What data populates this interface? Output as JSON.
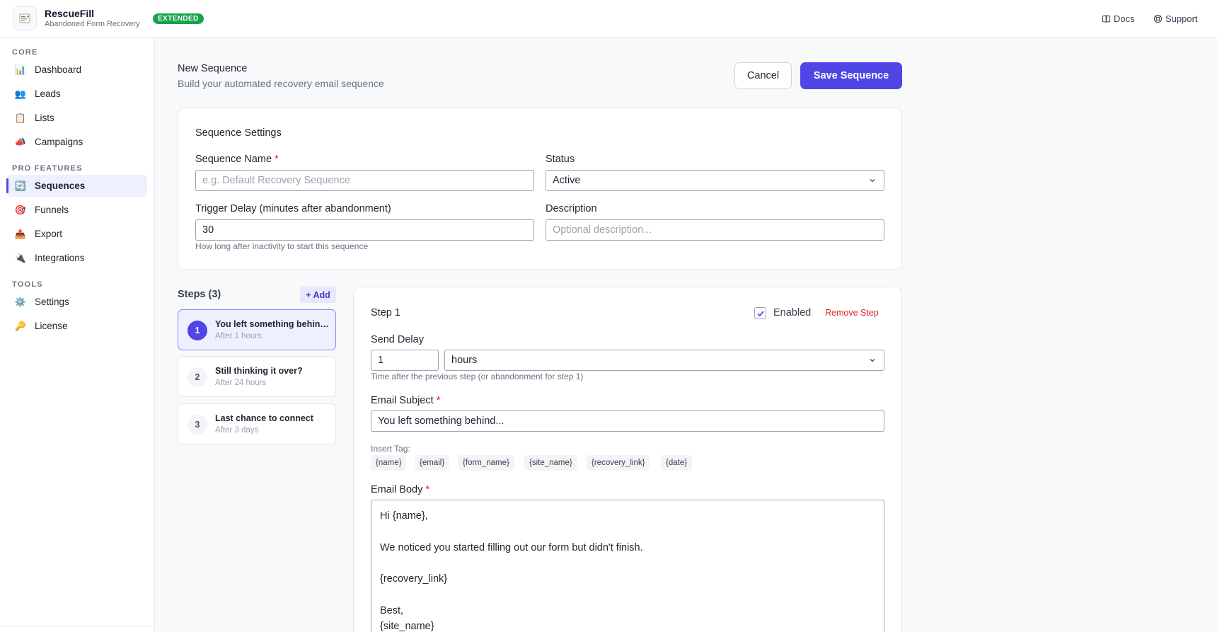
{
  "app": {
    "name": "RescueFill",
    "subtitle": "Abandoned Form Recovery",
    "badge": "EXTENDED",
    "badge_color": "#16a34a",
    "accent_color": "#4f46e5"
  },
  "top_links": {
    "docs": "Docs",
    "support": "Support"
  },
  "sidebar": {
    "sections": [
      {
        "title": "CORE",
        "items": [
          {
            "label": "Dashboard",
            "icon": "bar-chart-icon"
          },
          {
            "label": "Leads",
            "icon": "users-icon"
          },
          {
            "label": "Lists",
            "icon": "clipboard-icon"
          },
          {
            "label": "Campaigns",
            "icon": "megaphone-icon"
          }
        ]
      },
      {
        "title": "PRO FEATURES",
        "items": [
          {
            "label": "Sequences",
            "icon": "refresh-icon",
            "active": true
          },
          {
            "label": "Funnels",
            "icon": "target-icon"
          },
          {
            "label": "Export",
            "icon": "outbox-icon"
          },
          {
            "label": "Integrations",
            "icon": "plug-icon"
          }
        ]
      },
      {
        "title": "TOOLS",
        "items": [
          {
            "label": "Settings",
            "icon": "gear-icon"
          },
          {
            "label": "License",
            "icon": "key-icon"
          }
        ]
      }
    ]
  },
  "page": {
    "title": "New Sequence",
    "subtitle": "Build your automated recovery email sequence",
    "cancel_label": "Cancel",
    "save_label": "Save Sequence"
  },
  "settings": {
    "title": "Sequence Settings",
    "name_label": "Sequence Name",
    "name_placeholder": "e.g. Default Recovery Sequence",
    "name_value": "",
    "status_label": "Status",
    "status_value": "Active",
    "delay_label": "Trigger Delay (minutes after abandonment)",
    "delay_value": "30",
    "delay_hint": "How long after inactivity to start this sequence",
    "description_label": "Description",
    "description_placeholder": "Optional description...",
    "required_mark": "*"
  },
  "steps": {
    "title": "Steps (3)",
    "add_label": "+ Add",
    "items": [
      {
        "number": "1",
        "name": "You left something behind...",
        "after": "After 1 hours",
        "active": true
      },
      {
        "number": "2",
        "name": "Still thinking it over?",
        "after": "After 24 hours"
      },
      {
        "number": "3",
        "name": "Last chance to connect",
        "after": "After 3 days"
      }
    ]
  },
  "editor": {
    "title": "Step 1",
    "enabled_label": "Enabled",
    "enabled": true,
    "remove_label": "Remove Step",
    "send_delay_label": "Send Delay",
    "send_delay_value": "1",
    "send_delay_unit": "hours",
    "send_delay_hint": "Time after the previous step (or abandonment for step 1)",
    "subject_label": "Email Subject",
    "subject_value": "You left something behind...",
    "insert_tag_label": "Insert Tag:",
    "tags": [
      "{name}",
      "{email}",
      "{form_name}",
      "{site_name}",
      "{recovery_link}",
      "{date}"
    ],
    "body_label": "Email Body",
    "body_lines": [
      "Hi {name},",
      "",
      "We noticed you started filling out our form but didn't finish.",
      "",
      "{recovery_link}",
      "",
      "Best,",
      "{site_name}"
    ]
  }
}
